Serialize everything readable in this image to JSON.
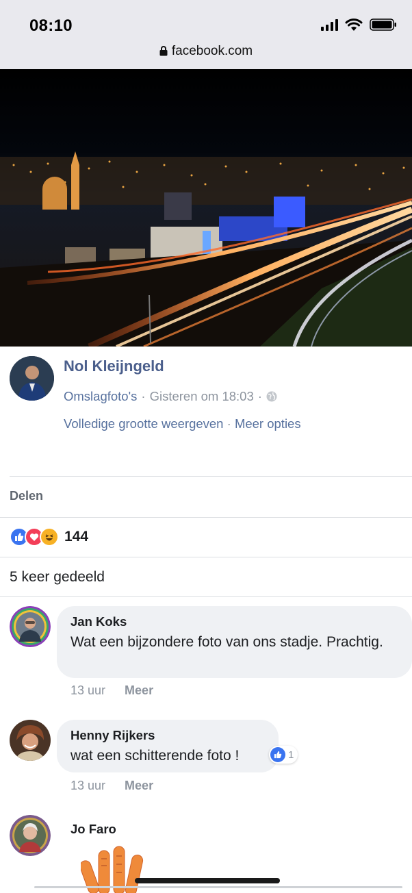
{
  "status_bar": {
    "time": "08:10"
  },
  "browser": {
    "url": "facebook.com",
    "lock_icon": "lock-icon"
  },
  "post": {
    "author": "Nol Kleijngeld",
    "album": "Omslagfoto's",
    "separator": "·",
    "time": "Gisteren om 18:03",
    "privacy_icon": "globe-icon",
    "view_full": "Volledige grootte weergeven",
    "more_options": "Meer opties"
  },
  "share_label": "Delen",
  "reactions": {
    "icons": [
      "like-icon",
      "love-icon",
      "haha-icon"
    ],
    "count": "144"
  },
  "shares_text": "5 keer gedeeld",
  "comments": [
    {
      "name": "Jan Koks",
      "text": "Wat een bijzondere foto van ons stadje. Prachtig.",
      "time": "13 uur",
      "more": "Meer"
    },
    {
      "name": "Henny Rijkers",
      "text": "wat een schitterende foto !",
      "time": "13 uur",
      "more": "Meer",
      "likes": "1"
    },
    {
      "name": "Jo Faro"
    }
  ],
  "colors": {
    "link": "#57719e",
    "author": "#4b5f8c",
    "like_blue": "#3a74f0",
    "love_red": "#f33e58",
    "haha_yellow": "#f7b125",
    "bubble": "#eff1f4"
  }
}
